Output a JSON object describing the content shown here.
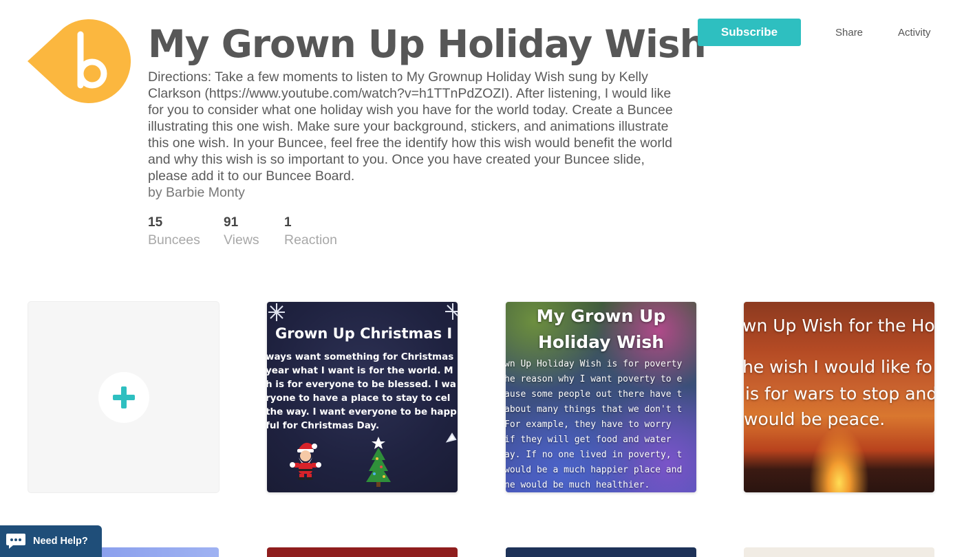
{
  "brand": {
    "logo_letter": "b",
    "logo_color": "#fbb73f"
  },
  "header": {
    "title": "My Grown Up Holiday Wish",
    "directions": "Directions: Take a few moments to listen to My Grownup Holiday Wish sung by Kelly Clarkson (https://www.youtube.com/watch?v=h1TTnPdZOZI). After listening, I would like for you to consider what one holiday wish you have for the world today. Create a Buncee illustrating this one wish. Make sure your background, stickers, and animations illustrate this one wish. In your Buncee, feel free the identify how this wish would benefit the world and why this wish is so important to you. Once you have created your Buncee slide, please add it to our Buncee Board.",
    "byline": "by Barbie Monty"
  },
  "stats": [
    {
      "value": "15",
      "label": "Buncees"
    },
    {
      "value": "91",
      "label": "Views"
    },
    {
      "value": "1",
      "label": "Reaction"
    }
  ],
  "actions": {
    "subscribe_label": "Subscribe",
    "share_label": "Share",
    "activity_label": "Activity",
    "accent_color": "#2ebfc0"
  },
  "cards": [
    {
      "type": "add",
      "icon": "plus-icon"
    },
    {
      "type": "buncee",
      "heading": "Grown Up Christmas I",
      "lines": [
        "ways want something for Christmas",
        " year what I want is for the world. M",
        "h is for everyone to be blessed. I wa",
        "ryone to have a place to stay to cel",
        "the way. I want everyone to be happ",
        "ful for Christmas Day."
      ]
    },
    {
      "type": "buncee",
      "heading_lines": [
        "My Grown Up",
        "Holiday Wish"
      ],
      "lines": [
        "wn Up Holiday Wish is for poverty",
        "he reason why I want poverty to e",
        "ause some people out there have t",
        "about many things that we don't t",
        "  For example, they have to worry",
        "  if they will get food and water",
        "ay. If no one lived in poverty, t",
        " would be a much happier place and",
        "ne would be much healthier."
      ]
    },
    {
      "type": "buncee",
      "lines": [
        "wn Up Wish for the Ho",
        "he wish I would like fo",
        " is for wars to stop and",
        "would be peace."
      ]
    }
  ],
  "help": {
    "label": "Need Help?"
  }
}
